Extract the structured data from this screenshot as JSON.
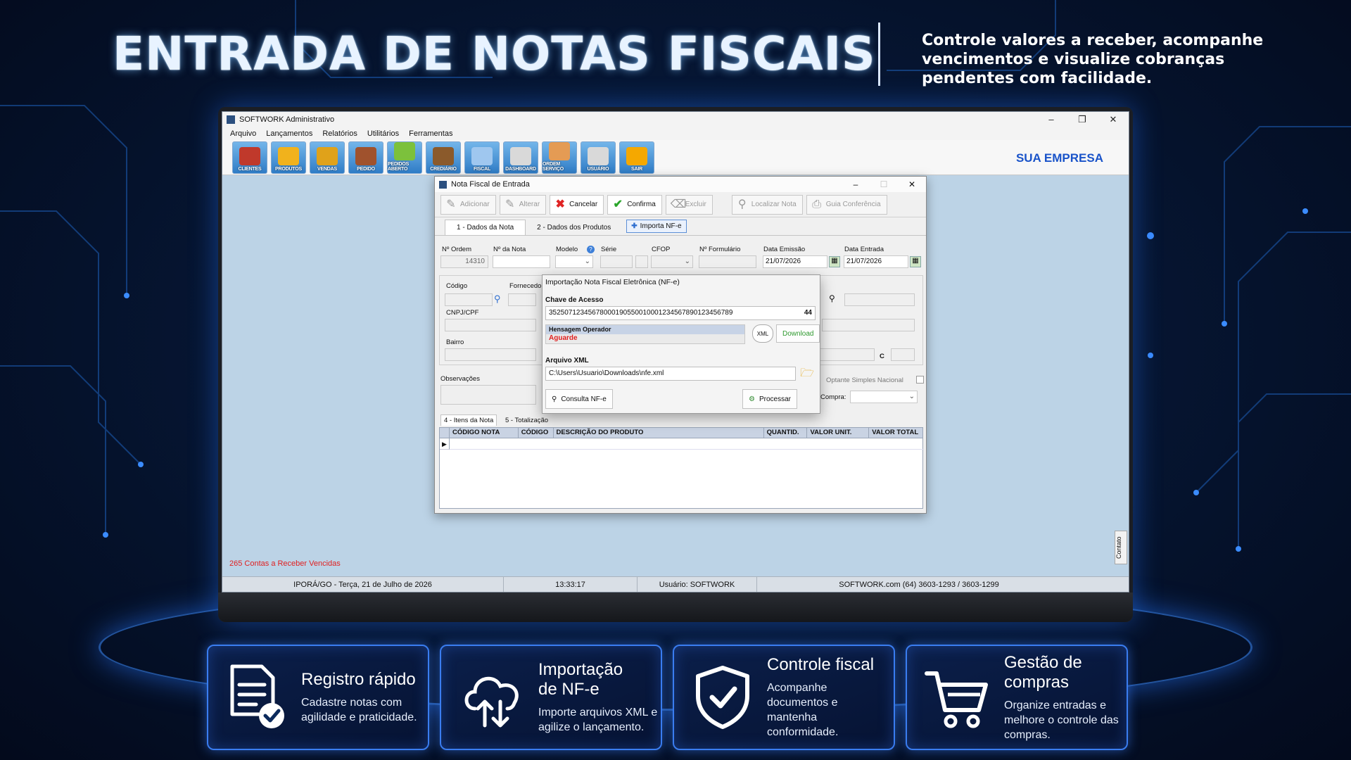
{
  "headline": "ENTRADA DE NOTAS FISCAIS",
  "subhead": "Controle valores a receber, acompanhe vencimentos e visualize cobranças pendentes com facilidade.",
  "app": {
    "title": "SOFTWORK Administrativo",
    "menu": [
      "Arquivo",
      "Lançamentos",
      "Relatórios",
      "Utilitários",
      "Ferramentas"
    ],
    "toolbar": [
      {
        "label": "CLIENTES",
        "color": "#c0392b"
      },
      {
        "label": "PRODUTOS",
        "color": "#f1b21c"
      },
      {
        "label": "VENDAS",
        "color": "#e0a21a"
      },
      {
        "label": "PEDIDO",
        "color": "#a0522d"
      },
      {
        "label": "PEDIDOS ABERTO",
        "color": "#7cc13c"
      },
      {
        "label": "CREDIÁRIO",
        "color": "#8b5a2b"
      },
      {
        "label": "FISCAL",
        "color": "#9fc7ef"
      },
      {
        "label": "DASHBOARD",
        "color": "#d9d9d9"
      },
      {
        "label": "ORDEM SERVIÇO",
        "color": "#e49b54"
      },
      {
        "label": "USUÁRIO",
        "color": "#d9d9d9"
      },
      {
        "label": "SAIR",
        "color": "#f5a800"
      }
    ],
    "company": "SUA EMPRESA",
    "alert": "265 Contas a Receber Vencidas",
    "status": {
      "location_date": "IPORÁ/GO - Terça, 21 de Julho de 2026",
      "time": "13:33:17",
      "user": "Usuário: SOFTWORK",
      "contact": "SOFTWORK.com (64) 3603-1293 / 3603-1299"
    },
    "contato_tab": "Contato"
  },
  "dialog": {
    "title": "Nota Fiscal de Entrada",
    "actions": {
      "adicionar": "Adicionar",
      "alterar": "Alterar",
      "cancelar": "Cancelar",
      "confirma": "Confirma",
      "excluir": "Excluir",
      "localizar": "Localizar Nota",
      "guia": "Guia Conferência"
    },
    "tabs": {
      "dados_nota": "1 - Dados da Nota",
      "dados_produtos": "2 - Dados dos Produtos",
      "importa": "Importa NF-e"
    },
    "fields": {
      "ordem_lbl": "Nº Ordem",
      "ordem_val": "14310",
      "nota_lbl": "Nº da Nota",
      "modelo_lbl": "Modelo",
      "serie_lbl": "Série",
      "cfop_lbl": "CFOP",
      "formulario_lbl": "Nº Formulário",
      "emissao_lbl": "Data Emissão",
      "emissao_val": "21/07/2026",
      "entrada_lbl": "Data Entrada",
      "entrada_val": "21/07/2026",
      "codigo_lbl": "Código",
      "fornecedor_lbl": "Fornecedor",
      "cnpj_lbl": "CNPJ/CPF",
      "bairro_lbl": "Bairro",
      "obs_lbl": "Observações",
      "simples_lbl": "Optante Simples Nacional",
      "compra_lbl": "Compra:",
      "c_lbl": "C"
    },
    "subtabs": {
      "itens": "4 - Itens da Nota",
      "totalizacao": "5 - Totalização"
    },
    "grid_columns": [
      "CÓDIGO NOTA",
      "CÓDIGO",
      "DESCRIÇÃO DO PRODUTO",
      "QUANTID.",
      "VALOR UNIT.",
      "VALOR TOTAL"
    ]
  },
  "import": {
    "title": "Importação Nota Fiscal Eletrônica (NF-e)",
    "chave_lbl": "Chave de Acesso",
    "chave_val": "35250712345678000190550010001234567890123456789",
    "chave_len": "44",
    "msg_lbl": "Hensagem Operador",
    "msg_val": "Aguarde",
    "xml_icon_text": "XML",
    "download": "Download",
    "arquivo_lbl": "Arquivo XML",
    "arquivo_val": "C:\\Users\\Usuario\\Downloads\\nfe.xml",
    "consulta": "Consulta NF-e",
    "processar": "Processar"
  },
  "cards": [
    {
      "title": "Registro rápido",
      "desc": "Cadastre notas com agilidade e praticidade.",
      "icon": "document-check-icon"
    },
    {
      "title": "Importação de NF-e",
      "desc": "Importe arquivos XML e agilize o lançamento.",
      "icon": "cloud-upload-icon"
    },
    {
      "title": "Controle fiscal",
      "desc": "Acompanhe documentos e mantenha conformidade.",
      "icon": "shield-check-icon"
    },
    {
      "title": "Gestão de compras",
      "desc": "Organize entradas e melhore o controle das compras.",
      "icon": "cart-icon"
    }
  ],
  "colors": {
    "accent": "#3a7df0",
    "company": "#1953c9",
    "alert": "#e02020",
    "aguarde": "#e02020",
    "download": "#2f9a2f"
  }
}
